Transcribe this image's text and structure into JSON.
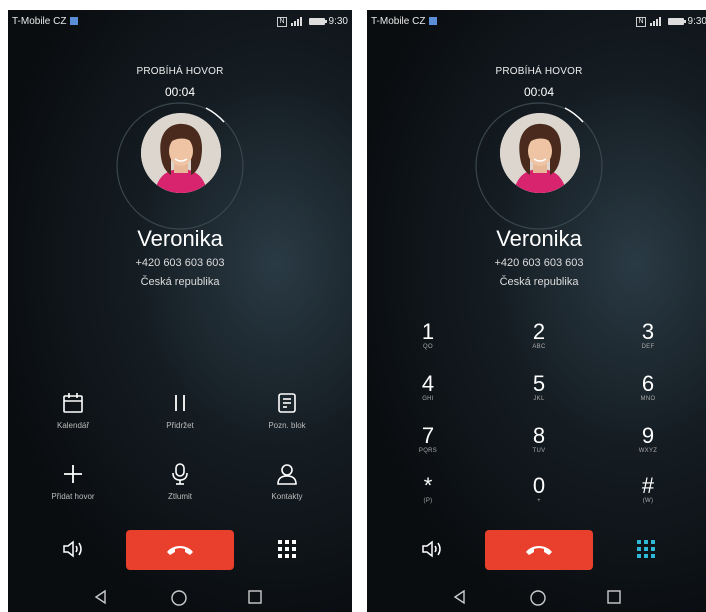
{
  "colors": {
    "end_call": "#e8402d",
    "keypad_active": "#2fb8d8",
    "icon": "#ffffff"
  },
  "left": {
    "status": {
      "carrier": "T-Mobile CZ",
      "time": "9:30"
    },
    "call_status": "PROBÍHÁ HOVOR",
    "timer": "00:04",
    "caller": {
      "name": "Veronika",
      "number": "+420 603 603 603",
      "country": "Česká republika"
    },
    "actions": [
      {
        "label": "Kalendář",
        "icon": "calendar-icon"
      },
      {
        "label": "Přidržet",
        "icon": "pause-icon"
      },
      {
        "label": "Pozn. blok",
        "icon": "notepad-icon"
      },
      {
        "label": "Přidat hovor",
        "icon": "plus-icon"
      },
      {
        "label": "Ztlumit",
        "icon": "microphone-icon"
      },
      {
        "label": "Kontakty",
        "icon": "person-icon"
      }
    ]
  },
  "right": {
    "status": {
      "carrier": "T-Mobile CZ",
      "time": "9:30"
    },
    "call_status": "PROBÍHÁ HOVOR",
    "timer": "00:04",
    "caller": {
      "name": "Veronika",
      "number": "+420 603 603 603",
      "country": "Česká republika"
    },
    "keys": [
      {
        "digit": "1",
        "letters": "QO"
      },
      {
        "digit": "2",
        "letters": "ABC"
      },
      {
        "digit": "3",
        "letters": "DEF"
      },
      {
        "digit": "4",
        "letters": "GHI"
      },
      {
        "digit": "5",
        "letters": "JKL"
      },
      {
        "digit": "6",
        "letters": "MNO"
      },
      {
        "digit": "7",
        "letters": "PQRS"
      },
      {
        "digit": "8",
        "letters": "TUV"
      },
      {
        "digit": "9",
        "letters": "WXYZ"
      },
      {
        "digit": "*",
        "letters": "(P)"
      },
      {
        "digit": "0",
        "letters": "+"
      },
      {
        "digit": "#",
        "letters": "(W)"
      }
    ]
  }
}
